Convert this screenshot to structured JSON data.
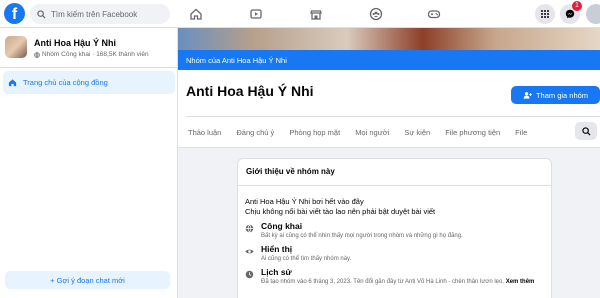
{
  "topbar": {
    "logo": "f",
    "search_placeholder": "Tìm kiếm trên Facebook",
    "nav_icons": [
      "home-icon",
      "video-icon",
      "marketplace-icon",
      "groups-icon",
      "gaming-icon"
    ],
    "notification_count": "1"
  },
  "sidebar": {
    "group_name": "Anti Hoa Hậu Ý Nhi",
    "group_meta": "Nhóm Công khai · 168,5K thành viên",
    "home_label": "Trang chủ của cộng đồng",
    "chat_button": "+ Gợi ý đoạn chat mới"
  },
  "main": {
    "cover_banner": "Nhóm của Anti Hoa Hậu Ý Nhi",
    "title": "Anti Hoa Hậu Ý Nhi",
    "join_button": "Tham gia nhóm",
    "tabs": [
      "Thảo luận",
      "Đáng chú ý",
      "Phòng họp mặt",
      "Mọi người",
      "Sự kiện",
      "File phương tiện",
      "File"
    ]
  },
  "about": {
    "title": "Giới thiệu về nhóm này",
    "desc_line1": "Anti Hoa Hậu Ý Nhi bơi hết vào đây",
    "desc_line2": "Chịu không nổi bài viết tào lao nên phải bật duyệt bài viết",
    "items": [
      {
        "icon": "globe-icon",
        "title": "Công khai",
        "text": "Bất kỳ ai cũng có thể nhìn thấy mọi người trong nhóm và những gì họ đăng."
      },
      {
        "icon": "eye-icon",
        "title": "Hiển thị",
        "text": "Ai cũng có thể tìm thấy nhóm này."
      },
      {
        "icon": "clock-icon",
        "title": "Lịch sử",
        "text": "Đã tạo nhóm vào 6 tháng 3, 2023. Tên đổi gần đây từ Anti Võ Hà Linh - chén thân lươn lẹo.",
        "more": "Xem thêm"
      }
    ]
  },
  "colors": {
    "brand": "#1877f2",
    "badge": "#e41e3f"
  }
}
